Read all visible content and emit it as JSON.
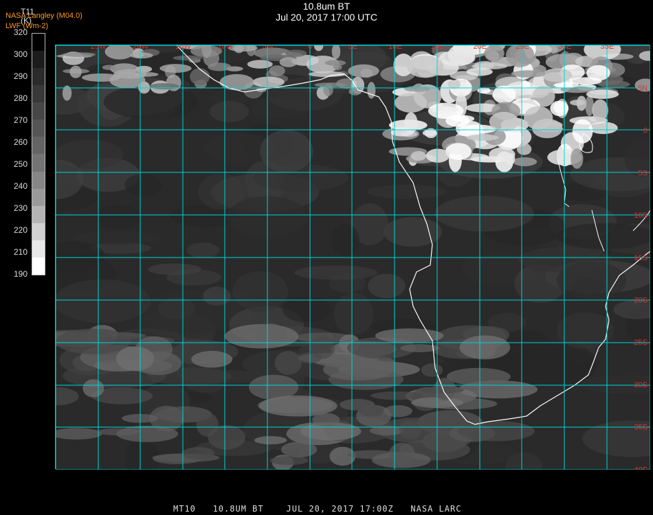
{
  "title": {
    "line1": "10.8um BT",
    "line2": "Jul 20, 2017 17:00 UTC"
  },
  "credit": {
    "line1": "NASA Langley (M04.0)",
    "line2": "LWF (Wm-2)"
  },
  "colorbar": {
    "title": "T11",
    "unit": "(K)",
    "ticks": [
      "320",
      "300",
      "290",
      "280",
      "270",
      "260",
      "250",
      "240",
      "230",
      "220",
      "210",
      "190"
    ],
    "colors": [
      "#000000",
      "#1c1c1c",
      "#2b2b2b",
      "#393939",
      "#474747",
      "#555555",
      "#646464",
      "#747474",
      "#868686",
      "#9a9a9a",
      "#b4b4b4",
      "#d0d0d0",
      "#e8e8e8",
      "#ffffff"
    ]
  },
  "map": {
    "grid_color": "#00d6d6",
    "label_color": "#e53030",
    "coast_color": "#ffffff",
    "lon_labels": [
      "25W",
      "20W",
      "15W",
      "10W",
      "5W",
      "0",
      "5E",
      "10E",
      "15E",
      "20E",
      "25E",
      "30E",
      "35E"
    ],
    "lat_labels": [
      "5N",
      "0",
      "5S",
      "10S",
      "15S",
      "20S",
      "25S",
      "30S",
      "35S",
      "40S"
    ]
  },
  "footer": {
    "text": "MT10   10.8UM BT    JUL 20, 2017 17:00Z   NASA LARC"
  }
}
